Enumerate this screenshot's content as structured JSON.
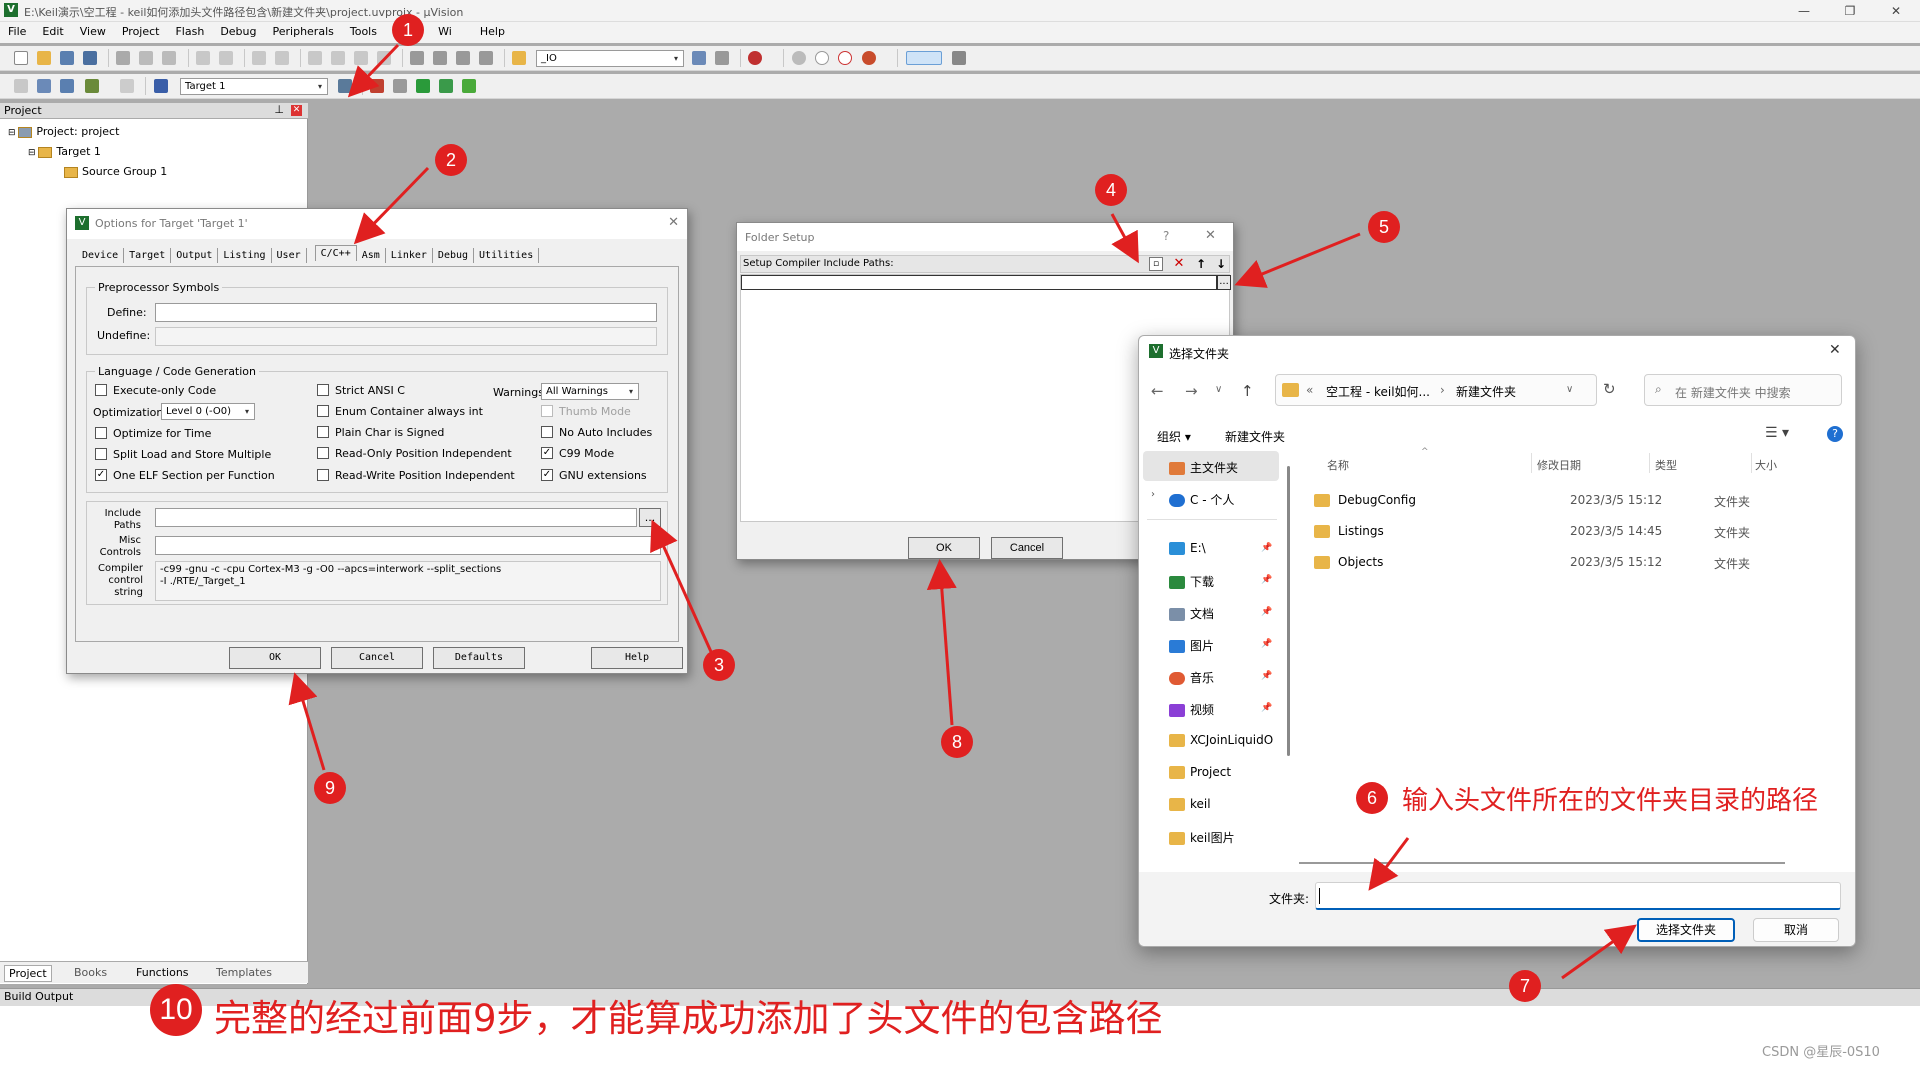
{
  "window": {
    "title": "E:\\Keil演示\\空工程 - keil如何添加头文件路径包含\\新建文件夹\\project.uvprojx - µVision",
    "logo": "V"
  },
  "menu": [
    "File",
    "Edit",
    "View",
    "Project",
    "Flash",
    "Debug",
    "Peripherals",
    "Tools",
    "SVCS",
    "Wi",
    "Help"
  ],
  "toolbar1": {
    "search_combo": "_IO"
  },
  "toolbar2": {
    "target_combo": "Target 1"
  },
  "project_pane": {
    "header": "Project",
    "tree": [
      "Project: project",
      "Target 1",
      "Source Group 1"
    ],
    "tabs": [
      "Project",
      "Books",
      "Functions",
      "Templates"
    ]
  },
  "build_output": {
    "header": "Build Output",
    "watermark": "CSDN @星辰-0S10"
  },
  "options_dialog": {
    "title": "Options for Target 'Target 1'",
    "tabs": [
      "Device",
      "Target",
      "Output",
      "Listing",
      "User",
      "C/C++",
      "Asm",
      "Linker",
      "Debug",
      "Utilities"
    ],
    "preprocessor": {
      "group": "Preprocessor Symbols",
      "define_label": "Define:",
      "undefine_label": "Undefine:"
    },
    "language": {
      "group": "Language / Code Generation",
      "execute_only": "Execute-only Code",
      "optimization_label": "Optimization:",
      "optimization_value": "Level 0 (-O0)",
      "optimize_time": "Optimize for Time",
      "split_load": "Split Load and Store Multiple",
      "one_elf": "One ELF Section per Function",
      "strict_ansi": "Strict ANSI C",
      "enum_container": "Enum Container always int",
      "plain_char": "Plain Char is Signed",
      "ro_pos": "Read-Only Position Independent",
      "rw_pos": "Read-Write Position Independent",
      "warnings_label": "Warnings:",
      "warnings_value": "All Warnings",
      "thumb_mode": "Thumb Mode",
      "no_auto": "No Auto Includes",
      "c99": "C99 Mode",
      "gnu_ext": "GNU extensions"
    },
    "include_label": "Include Paths",
    "misc_label": "Misc Controls",
    "compiler_label": "Compiler control string",
    "compiler_line1": "-c99 -gnu -c -cpu Cortex-M3 -g -O0 --apcs=interwork --split_sections",
    "compiler_line2": "-I ./RTE/_Target_1",
    "browse": "...",
    "buttons": {
      "ok": "OK",
      "cancel": "Cancel",
      "defaults": "Defaults",
      "help": "Help"
    }
  },
  "folder_setup": {
    "title": "Folder Setup",
    "question": "?",
    "close": "✕",
    "label": "Setup Compiler Include Paths:",
    "browse": "...",
    "ok": "OK",
    "cancel": "Cancel"
  },
  "select_folder": {
    "title": "选择文件夹",
    "path_prefix": "«",
    "path_a": "空工程 - keil如何...",
    "path_sep": "›",
    "path_b": "新建文件夹",
    "search_placeholder": "在 新建文件夹 中搜索",
    "organize": "组织 ▾",
    "new_folder": "新建文件夹",
    "columns": {
      "name": "名称",
      "date": "修改日期",
      "type": "类型",
      "size": "大小"
    },
    "nav": [
      {
        "label": "主文件夹",
        "color": "#e07a3a"
      },
      {
        "label": "C - 个人",
        "color": "#1f6fd1"
      },
      {
        "label": "E:\\",
        "color": "#2a8fd8"
      },
      {
        "label": "下载",
        "color": "#2b8a3e"
      },
      {
        "label": "文档",
        "color": "#7b8fa8"
      },
      {
        "label": "图片",
        "color": "#2a7bd6"
      },
      {
        "label": "音乐",
        "color": "#e05a33"
      },
      {
        "label": "视频",
        "color": "#8b3fd6"
      },
      {
        "label": "XCJoinLiquidO",
        "color": "#e8b548"
      },
      {
        "label": "Project",
        "color": "#e8b548"
      },
      {
        "label": "keil",
        "color": "#e8b548"
      },
      {
        "label": "keil图片",
        "color": "#e8b548"
      }
    ],
    "files": [
      {
        "name": "DebugConfig",
        "date": "2023/3/5 15:12",
        "type": "文件夹"
      },
      {
        "name": "Listings",
        "date": "2023/3/5 14:45",
        "type": "文件夹"
      },
      {
        "name": "Objects",
        "date": "2023/3/5 15:12",
        "type": "文件夹"
      }
    ],
    "folder_label": "文件夹:",
    "select_button": "选择文件夹",
    "cancel_button": "取消"
  },
  "annotations": {
    "badges": [
      "1",
      "2",
      "3",
      "4",
      "5",
      "6",
      "7",
      "8",
      "9",
      "10"
    ],
    "note6": "输入头文件所在的文件夹目录的路径",
    "note10": "完整的经过前面9步，才能算成功添加了头文件的包含路径"
  },
  "colors": {
    "accent_red": "#e02020",
    "keil_green": "#1d6f2e",
    "win_blue": "#005fb8"
  }
}
